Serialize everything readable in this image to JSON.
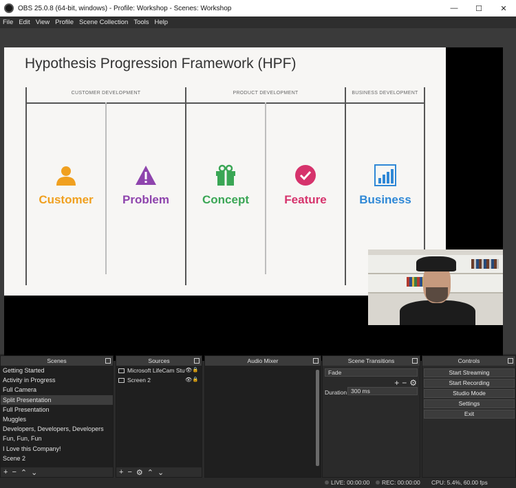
{
  "window": {
    "title": "OBS 25.0.8 (64-bit, windows) - Profile: Workshop - Scenes: Workshop",
    "minimize_label": "—",
    "maximize_label": "☐",
    "close_label": "✕"
  },
  "menu": [
    "File",
    "Edit",
    "View",
    "Profile",
    "Scene Collection",
    "Tools",
    "Help"
  ],
  "slide": {
    "title": "Hypothesis Progression Framework (HPF)",
    "sections": [
      "CUSTOMER DEVELOPMENT",
      "PRODUCT DEVELOPMENT",
      "BUSINESS DEVELOPMENT"
    ],
    "stages": [
      {
        "label": "Customer",
        "color": "#f0a020",
        "icon": "person-icon"
      },
      {
        "label": "Problem",
        "color": "#8e44ad",
        "icon": "warning-icon"
      },
      {
        "label": "Concept",
        "color": "#3aa655",
        "icon": "gift-icon"
      },
      {
        "label": "Feature",
        "color": "#d6336c",
        "icon": "checkmark-icon"
      },
      {
        "label": "Business",
        "color": "#2f88d6",
        "icon": "bar-chart-icon"
      }
    ]
  },
  "docks": {
    "scenes": {
      "title": "Scenes",
      "items": [
        "Getting Started",
        "Activity in Progress",
        "Full Camera",
        "Split Presentation",
        "Full Presentation",
        "Muggles",
        "Developers, Developers, Developers",
        "Fun, Fun, Fun",
        "I Love this Company!",
        "Scene 2"
      ],
      "selected": "Split Presentation"
    },
    "sources": {
      "title": "Sources",
      "items": [
        {
          "name": "Microsoft LifeCam Studio"
        },
        {
          "name": "Screen 2"
        }
      ]
    },
    "mixer": {
      "title": "Audio Mixer"
    },
    "transitions": {
      "title": "Scene Transitions",
      "selected": "Fade",
      "duration_label": "Duration",
      "duration_value": "300 ms"
    },
    "controls": {
      "title": "Controls",
      "buttons": [
        "Start Streaming",
        "Start Recording",
        "Studio Mode",
        "Settings",
        "Exit"
      ]
    }
  },
  "status": {
    "live": "LIVE: 00:00:00",
    "rec": "REC: 00:00:00",
    "cpu": "CPU: 5.4%, 60.00 fps"
  },
  "colors": {
    "slide_bg": "#f7f6f4",
    "dock_bg": "#2a2a2a",
    "selected_scene": "#3d3d3d"
  }
}
